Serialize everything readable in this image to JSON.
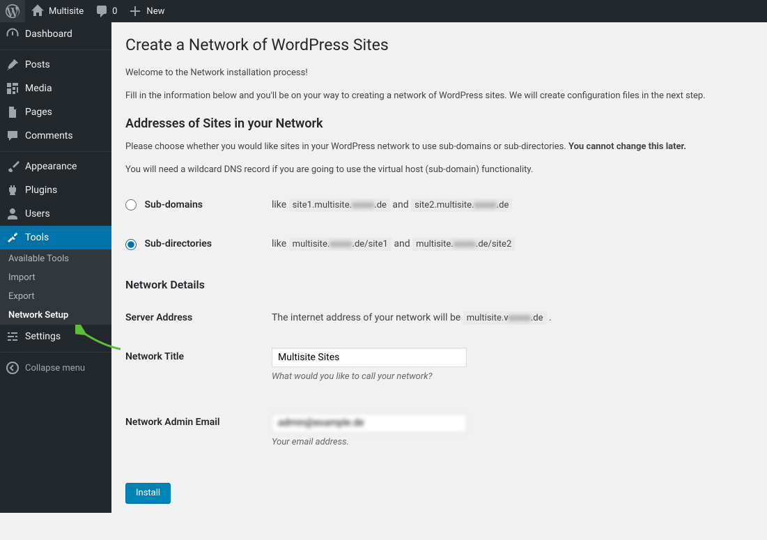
{
  "topbar": {
    "site_name": "Multisite",
    "comment_count": "0",
    "new_label": "New"
  },
  "sidebar": {
    "dashboard": "Dashboard",
    "posts": "Posts",
    "media": "Media",
    "pages": "Pages",
    "comments": "Comments",
    "appearance": "Appearance",
    "plugins": "Plugins",
    "users": "Users",
    "tools": "Tools",
    "tools_sub": {
      "available": "Available Tools",
      "import": "Import",
      "export": "Export",
      "network_setup": "Network Setup"
    },
    "settings": "Settings",
    "collapse": "Collapse menu"
  },
  "page": {
    "title": "Create a Network of WordPress Sites",
    "welcome": "Welcome to the Network installation process!",
    "intro": "Fill in the information below and you'll be on your way to creating a network of WordPress sites. We will create configuration files in the next step.",
    "addresses_heading": "Addresses of Sites in your Network",
    "addresses_desc_pre": "Please choose whether you would like sites in your WordPress network to use sub-domains or sub-directories. ",
    "addresses_desc_bold": "You cannot change this later.",
    "wildcard_note": "You will need a wildcard DNS record if you are going to use the virtual host (sub-domain) functionality.",
    "subdomains_label": "Sub-domains",
    "subdomains_like": "like ",
    "subdomains_ex1a": "site1.multisite.",
    "subdomains_ex1b": ".de",
    "subdomains_and": " and ",
    "subdomains_ex2a": "site2.multisite.",
    "subdomains_ex2b": ".de",
    "subdirs_label": "Sub-directories",
    "subdirs_ex1a": "multisite.",
    "subdirs_ex1b": ".de/site1",
    "subdirs_ex2a": "multisite.",
    "subdirs_ex2b": ".de/site2",
    "network_details_heading": "Network Details",
    "server_address_label": "Server Address",
    "server_address_pre": "The internet address of your network will be ",
    "server_address_code_a": "multisite.v",
    "server_address_code_b": ".de",
    "server_address_post": " .",
    "network_title_label": "Network Title",
    "network_title_value": "Multisite Sites",
    "network_title_desc": "What would you like to call your network?",
    "admin_email_label": "Network Admin Email",
    "admin_email_value": "admin@example.de",
    "admin_email_desc": "Your email address.",
    "install_btn": "Install"
  }
}
